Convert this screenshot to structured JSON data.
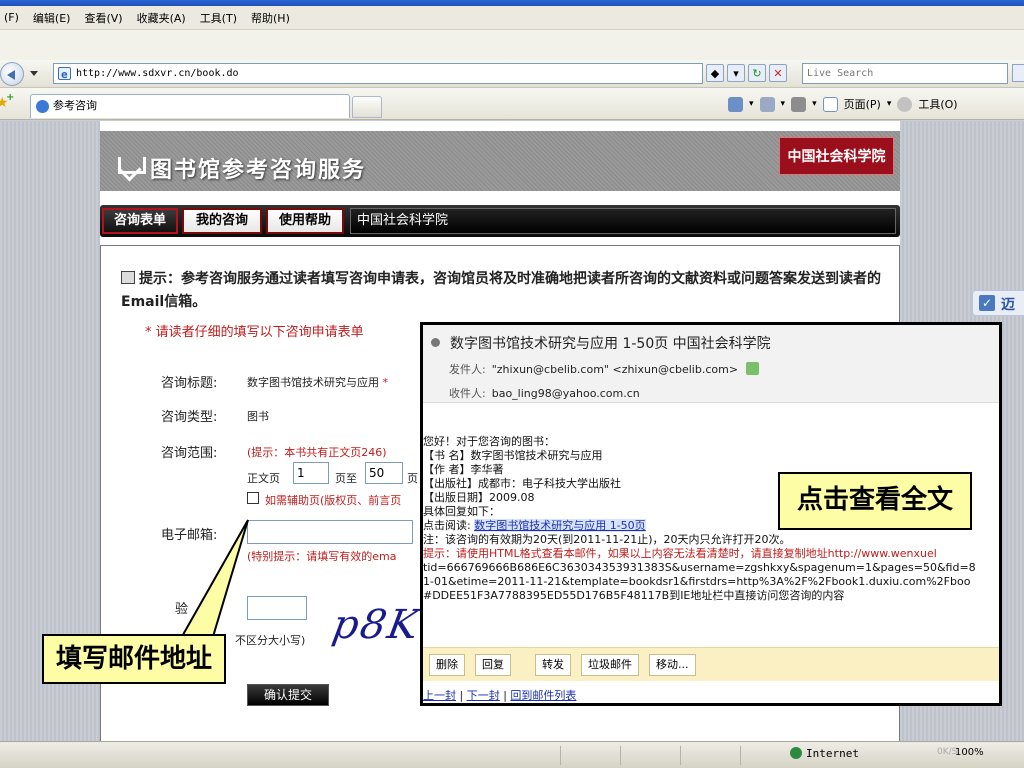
{
  "browser": {
    "menu": [
      "(F)",
      "编辑(E)",
      "查看(V)",
      "收藏夹(A)",
      "工具(T)",
      "帮助(H)"
    ],
    "address": "http://www.sdxvr.cn/book.do",
    "search_placeholder": "Live Search",
    "tab_title": "参考咨询",
    "cmd_page": "页面(P)",
    "cmd_tools": "工具(O)",
    "status_zone": "Internet",
    "status_zoom": "100%",
    "status_speed": "0K/S"
  },
  "site": {
    "banner_title": "图书馆参考咨询服务",
    "badge": "中国社会科学院",
    "tabs": [
      "咨询表单",
      "我的咨询",
      "使用帮助"
    ],
    "org_name": "中国社会科学院",
    "side_text": "迈"
  },
  "form": {
    "tip": "提示：参考咨询服务通过读者填写咨询申请表，咨询馆员将及时准确地把读者所咨询的文献资料或问题答案发送到读者的Email信箱。",
    "note": "* 请读者仔细的填写以下咨询申请表单",
    "title_label": "咨询标题:",
    "title_value": "数字图书馆技术研究与应用",
    "title_star": "*",
    "type_label": "咨询类型:",
    "type_value": "图书",
    "scope_label": "咨询范围:",
    "scope_hint": "(提示：本书共有正文页246)",
    "scope_from_label": "正文页",
    "scope_from": "1",
    "scope_to_label": "页至",
    "scope_to": "50",
    "scope_page": "页",
    "aux_label": "如需辅助页(版权页、前言页",
    "email_label": "电子邮箱:",
    "email_value": "",
    "email_hint": "(特别提示：请填写有效的ema",
    "verify_label": "验",
    "verify_value": "",
    "case_hint": "不区分大小写)",
    "captcha": "p8K",
    "submit": "确认提交"
  },
  "callouts": {
    "email": "填写邮件地址",
    "view": "点击查看全文"
  },
  "mail": {
    "subject": "数字图书馆技术研究与应用  1-50页  中国社会科学院",
    "from_label": "发件人:",
    "from": "\"zhixun@cbelib.com\" <zhixun@cbelib.com>",
    "to_label": "收件人:",
    "to": "bao_ling98@yahoo.com.cn",
    "body": [
      "您好！对于您咨询的图书：",
      "【书  名】数字图书馆技术研究与应用",
      "【作  者】李华著",
      "【出版社】成都市：电子科技大学出版社",
      "【出版日期】2009.08",
      "具体回复如下：",
      "点击阅读: ",
      "注：该咨询的有效期为20天(到2011-11-21止)，20天内只允许打开20次。",
      "提示：请使用HTML格式查看本邮件，如果以上内容无法看清楚时，请直接复制地址http://www.wenxuel",
      "tid=666769666B686E6C363034353931383S&username=zgshkxy&spagenum=1&pages=50&fid=8",
      "1-01&etime=2011-11-21&template=bookdsr1&firstdrs=http%3A%2F%2Fbook1.duxiu.com%2Fboo",
      "#DDEE51F3A7788395ED55D176B5F48117B到IE地址栏中直接访问您咨询的内容"
    ],
    "read_link": "数字图书馆技术研究与应用  1-50页",
    "hint_prefix": "提示",
    "actions": [
      "删除",
      "回复",
      "转发",
      "垃圾邮件",
      "移动..."
    ],
    "foot_prev": "上一封",
    "foot_next": "下一封",
    "foot_list": "回到邮件列表"
  }
}
